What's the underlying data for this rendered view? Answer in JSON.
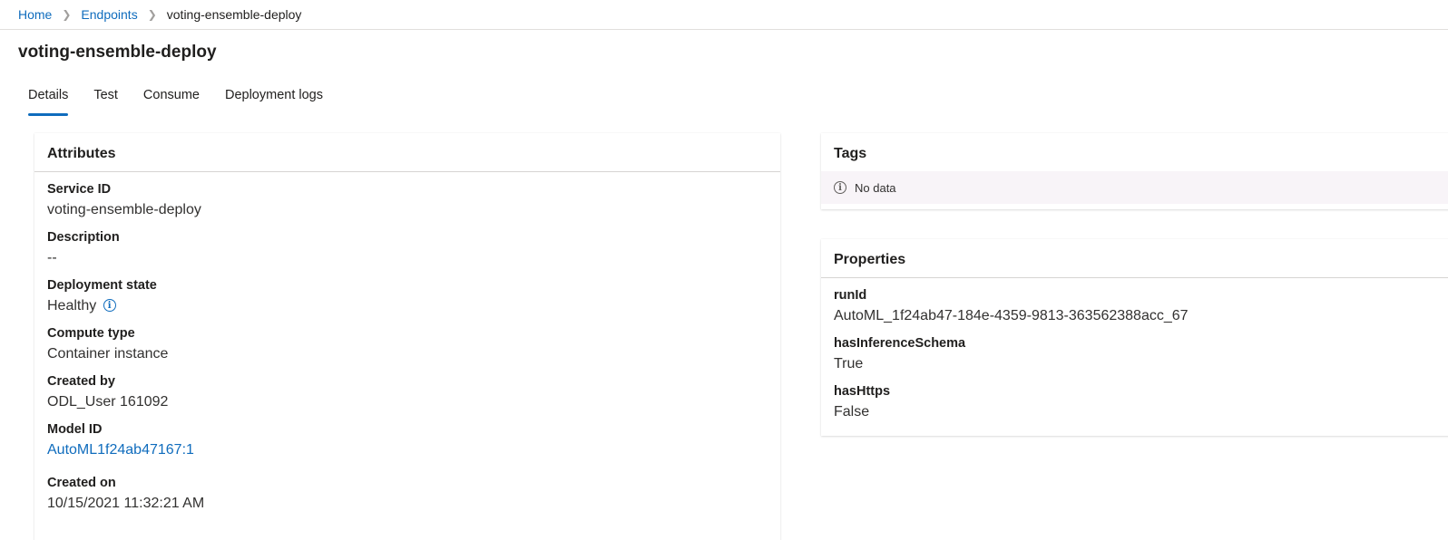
{
  "breadcrumb": {
    "home": "Home",
    "endpoints": "Endpoints",
    "current": "voting-ensemble-deploy"
  },
  "page_title": "voting-ensemble-deploy",
  "tabs": [
    {
      "label": "Details",
      "active": true
    },
    {
      "label": "Test",
      "active": false
    },
    {
      "label": "Consume",
      "active": false
    },
    {
      "label": "Deployment logs",
      "active": false
    }
  ],
  "attributes": {
    "title": "Attributes",
    "fields": [
      {
        "label": "Service ID",
        "value": "voting-ensemble-deploy"
      },
      {
        "label": "Description",
        "value": "--"
      },
      {
        "label": "Deployment state",
        "value": "Healthy"
      },
      {
        "label": "Compute type",
        "value": "Container instance"
      },
      {
        "label": "Created by",
        "value": "ODL_User 161092"
      },
      {
        "label": "Model ID",
        "value": "AutoML1f24ab47167:1"
      },
      {
        "label": "Created on",
        "value": "10/15/2021 11:32:21 AM"
      }
    ]
  },
  "tags": {
    "title": "Tags",
    "empty_text": "No data"
  },
  "properties": {
    "title": "Properties",
    "fields": [
      {
        "label": "runId",
        "value": "AutoML_1f24ab47-184e-4359-9813-363562388acc_67"
      },
      {
        "label": "hasInferenceSchema",
        "value": "True"
      },
      {
        "label": "hasHttps",
        "value": "False"
      }
    ]
  },
  "icons": {
    "breadcrumb_separator": "chevron-right-icon",
    "deployment_state_info": "info-icon",
    "tags_empty_info": "info-icon"
  },
  "colors": {
    "link": "#0f6cbd",
    "tab_indicator": "#0f6cbd",
    "empty_row_bg": "#f8f4f8"
  }
}
